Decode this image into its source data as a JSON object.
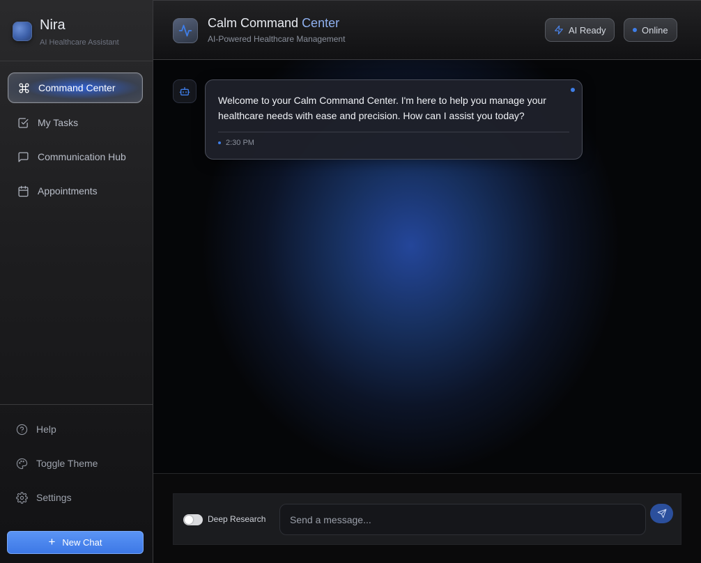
{
  "brand": {
    "name": "Nira",
    "subtitle": "AI Healthcare Assistant"
  },
  "sidebar": {
    "items": [
      {
        "label": "Command Center",
        "icon": "command-icon",
        "active": true
      },
      {
        "label": "My Tasks",
        "icon": "check-square-icon"
      },
      {
        "label": "Communication Hub",
        "icon": "message-icon"
      },
      {
        "label": "Appointments",
        "icon": "calendar-icon"
      }
    ],
    "bottom": [
      {
        "label": "Help",
        "icon": "help-circle-icon"
      },
      {
        "label": "Toggle Theme",
        "icon": "palette-icon"
      },
      {
        "label": "Settings",
        "icon": "gear-icon"
      }
    ],
    "new_chat_label": "New Chat"
  },
  "header": {
    "title_part1": "Calm Command",
    "title_part2": "Center",
    "subtitle": "AI-Powered Healthcare Management",
    "status_ai": "AI Ready",
    "status_online": "Online"
  },
  "chat": {
    "messages": [
      {
        "text": "Welcome to your Calm Command Center. I'm here to help you manage your healthcare needs with ease and precision. How can I assist you today?",
        "time": "2:30 PM"
      }
    ]
  },
  "composer": {
    "deep_research_label": "Deep Research",
    "deep_research_enabled": false,
    "placeholder": "Send a message..."
  },
  "colors": {
    "accent": "#3f7ee8",
    "new_chat_button": "#4a86ee",
    "sidebar_bg": "#1d1d1f",
    "header_bg": "#18181a",
    "main_glow": "#24469a"
  }
}
